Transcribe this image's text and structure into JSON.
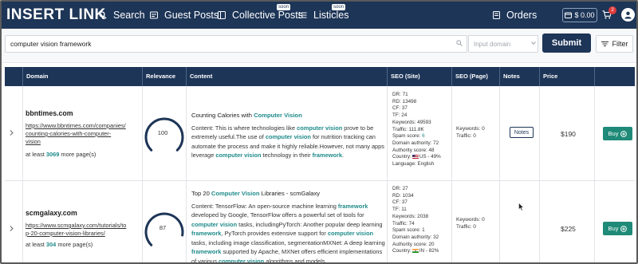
{
  "brand": {
    "logo_text": "INSERT LINK"
  },
  "nav": {
    "items": [
      {
        "label": "Search",
        "icon": "search-icon"
      },
      {
        "label": "Guest Posts",
        "icon": "guest-posts-icon"
      },
      {
        "label": "Collective Posts",
        "icon": "collective-posts-icon",
        "badge": "soon"
      },
      {
        "label": "Listicles",
        "icon": "listicles-icon",
        "badge": "soon"
      },
      {
        "label": "Orders",
        "icon": "orders-icon"
      }
    ],
    "wallet": "$ 0.00",
    "cart_count": "2"
  },
  "search": {
    "query": "computer vision framework",
    "domain_placeholder": "Input domain",
    "submit_label": "Submit",
    "filter_label": "Filter"
  },
  "table": {
    "headers": [
      "Domain",
      "Relevance",
      "Content",
      "SEO (Site)",
      "SEO (Page)",
      "Notes",
      "Price"
    ],
    "rows": [
      {
        "domain": "bbntimes.com",
        "url_lines": [
          "https://www.bbntimes.com/companies/",
          "counting-calories-with-computer-",
          "vision"
        ],
        "more_prefix": "at least",
        "more_count": "3069",
        "more_suffix": "more page(s)",
        "relevance": "100",
        "relevance_fraction": 1.0,
        "title_prefix": "Counting Calories with ",
        "title_highlight": "Computer Vision",
        "content_parts": [
          "Content: This is where technologies like ",
          "computer vision",
          " prove to be extremely useful.The use of ",
          "computer vision",
          " for nutrition tracking can automate the process and make it highly reliable.However, not many apps leverage ",
          "computer vision",
          " technology in their ",
          "framework",
          "."
        ],
        "seo_site": {
          "dr": "DR: 71",
          "rd": "RD: 13498",
          "cf": "CF: 37",
          "tf": "TF: 24",
          "keywords": "Keywords: 49593",
          "traffic": "Traffic: 111.8K",
          "spam_label": "Spam score: ",
          "spam_value": "6",
          "domain_authority": "Domain authority: 72",
          "authority_score": "Authority score: 48",
          "country_prefix": "Country:",
          "country_suffix": "US - 49%",
          "language": "Language: English"
        },
        "seo_page": {
          "keywords": "Keywords: 0",
          "traffic": "Traffic: 0"
        },
        "notes_label": "Notes",
        "price": "$190",
        "buy_label": "Buy"
      },
      {
        "domain": "scmgalaxy.com",
        "url_lines": [
          "https://www.scmgalaxy.com/tutorials/to",
          "p-20-computer-vision-libraries/"
        ],
        "more_prefix": "at least",
        "more_count": "304",
        "more_suffix": "more page(s)",
        "relevance": "87",
        "relevance_fraction": 0.87,
        "title_prefix": "Top 20 ",
        "title_highlight": "Computer Vision",
        "title_suffix": " Libraries - scmGalaxy",
        "content_parts": [
          "Content: TensorFlow: An open-source machine learning ",
          "framework",
          " developed by Google, TensorFlow offers a powerful set of tools for ",
          "computer vision",
          " tasks, includingPyTorch: Another popular deep learning ",
          "framework",
          ", PyTorch provides extensive support for ",
          "computer vision",
          " tasks, including image classification, segmentationMXNet: A deep learning ",
          "framework",
          " supported by Apache, MXNet offers efficient implementations of various ",
          "computer vision",
          " algorithms and models."
        ],
        "seo_site": {
          "dr": "DR: 27",
          "rd": "RD: 1034",
          "cf": "CF: 37",
          "tf": "TF: 11",
          "keywords": "Keywords: 2038",
          "traffic": "Traffic: 74",
          "spam_label": "Spam score: ",
          "spam_value": "1",
          "domain_authority": "Domain authority: 32",
          "authority_score": "Authority score: 20",
          "country_prefix": "Country:",
          "country_suffix": "IN - 82%"
        },
        "seo_page": {
          "keywords": "Keywords: 0",
          "traffic": "Traffic: 0"
        },
        "price": "$225",
        "buy_label": "Buy"
      }
    ]
  },
  "colors": {
    "navy": "#1d3557",
    "teal": "#1f8a8a",
    "buy_green": "#1f8a78"
  }
}
